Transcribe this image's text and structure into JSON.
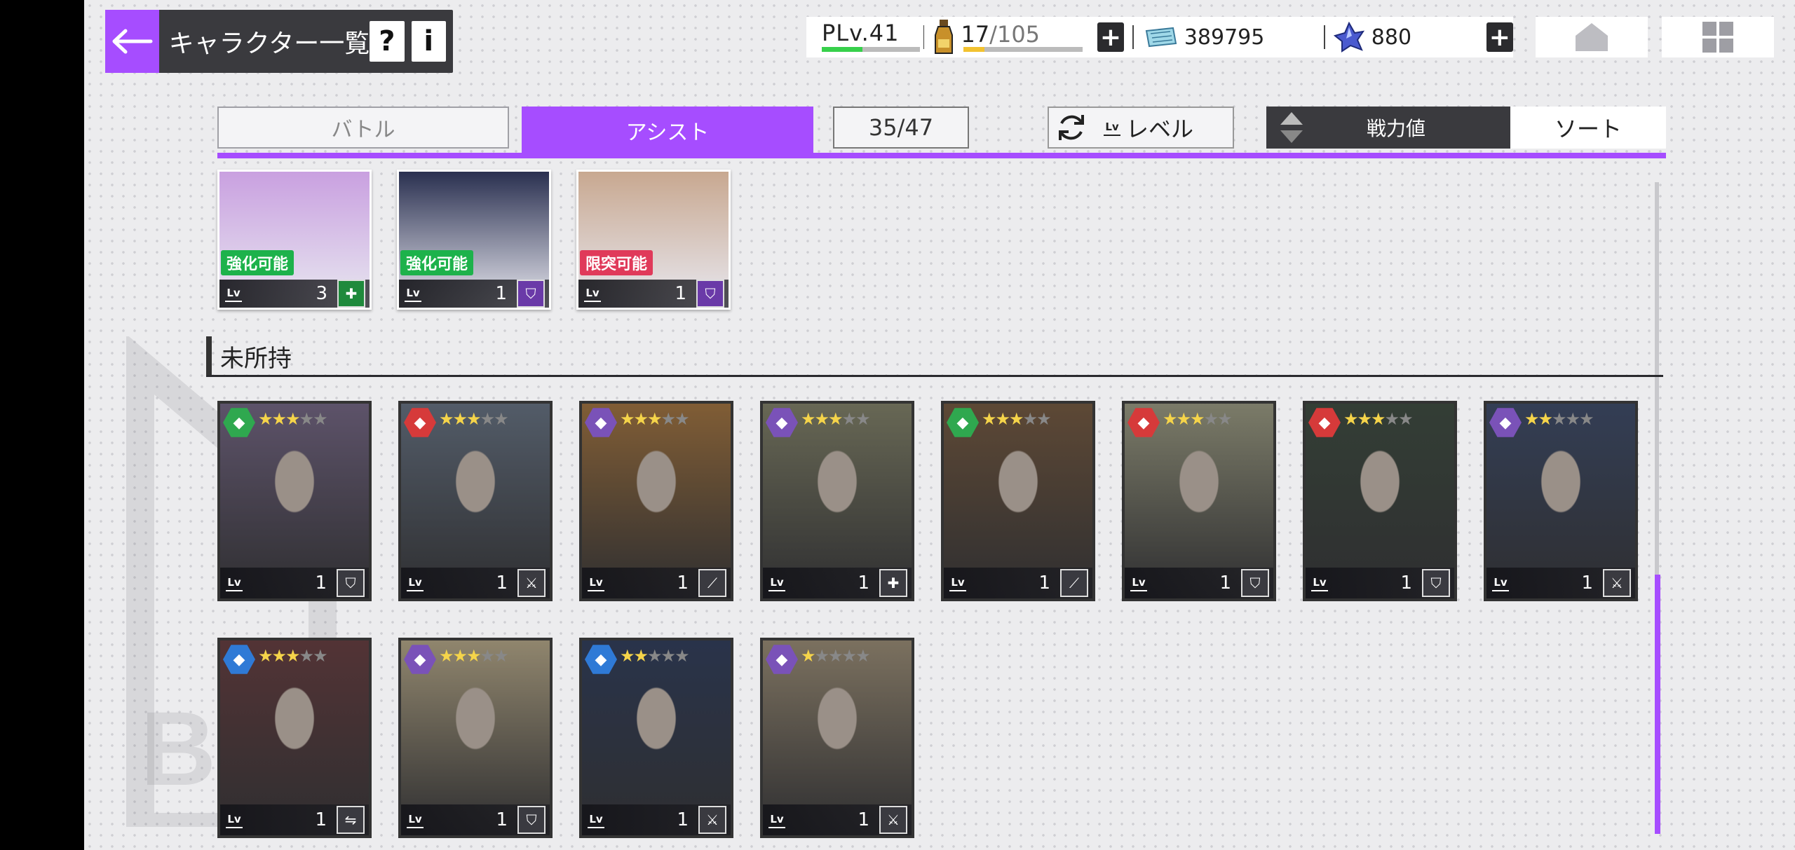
{
  "header": {
    "title": "キャラクター一覧",
    "help_label": "?",
    "info_label": "i"
  },
  "status": {
    "player_level": "PLv.41",
    "stamina_current": "17",
    "stamina_max": "/105",
    "tickets": "389795",
    "gems": "880",
    "plus_label": "+"
  },
  "tabs": {
    "battle": "バトル",
    "assist": "アシスト",
    "count": "35/47",
    "level_sort": "レベル",
    "power": "戦力値",
    "sort": "ソート"
  },
  "owned_cards": [
    {
      "lv": "3",
      "badge": "強化可能",
      "badge_color": "#1db24b",
      "role": "heal",
      "role_color": "#1f8a3c",
      "art": "#c9a0e0"
    },
    {
      "lv": "1",
      "badge": "強化可能",
      "badge_color": "#1db24b",
      "role": "shield",
      "role_color": "#6a3aa8",
      "art": "#2a3050"
    },
    {
      "lv": "1",
      "badge": "限突可能",
      "badge_color": "#e03a5a",
      "role": "shield",
      "role_color": "#6a3aa8",
      "art": "#c8a890"
    }
  ],
  "section": {
    "unowned_label": "未所持"
  },
  "unowned_cards": [
    {
      "lv": "1",
      "stars": 3,
      "attr": "green",
      "role": "shield",
      "bg": "#7a6a8a"
    },
    {
      "lv": "1",
      "stars": 3,
      "attr": "red",
      "role": "sword",
      "bg": "#6a7888"
    },
    {
      "lv": "1",
      "stars": 3,
      "attr": "purple",
      "role": "slash",
      "bg": "#b07a3a"
    },
    {
      "lv": "1",
      "stars": 3,
      "attr": "purple",
      "role": "heal",
      "bg": "#8a8a6a"
    },
    {
      "lv": "1",
      "stars": 3,
      "attr": "green",
      "role": "slash",
      "bg": "#7a5a3a"
    },
    {
      "lv": "1",
      "stars": 3,
      "attr": "red",
      "role": "shield",
      "bg": "#a8a888"
    },
    {
      "lv": "1",
      "stars": 3,
      "attr": "red",
      "role": "shield",
      "bg": "#3a4a3a"
    },
    {
      "lv": "1",
      "stars": 2,
      "attr": "purple",
      "role": "sword",
      "bg": "#3a4a6a"
    },
    {
      "lv": "1",
      "stars": 3,
      "attr": "blue",
      "role": "gun",
      "bg": "#6a3a3a"
    },
    {
      "lv": "1",
      "stars": 3,
      "attr": "purple",
      "role": "shield",
      "bg": "#c8b890"
    },
    {
      "lv": "1",
      "stars": 2,
      "attr": "blue",
      "role": "sword",
      "bg": "#2a3a5a"
    },
    {
      "lv": "1",
      "stars": 1,
      "attr": "purple",
      "role": "sword",
      "bg": "#a8987a"
    }
  ],
  "colors": {
    "accent": "#a64dff",
    "attr_green": "#2fa84f",
    "attr_red": "#d63a3a",
    "attr_purple": "#7a52b8",
    "attr_blue": "#2f7ad6"
  }
}
